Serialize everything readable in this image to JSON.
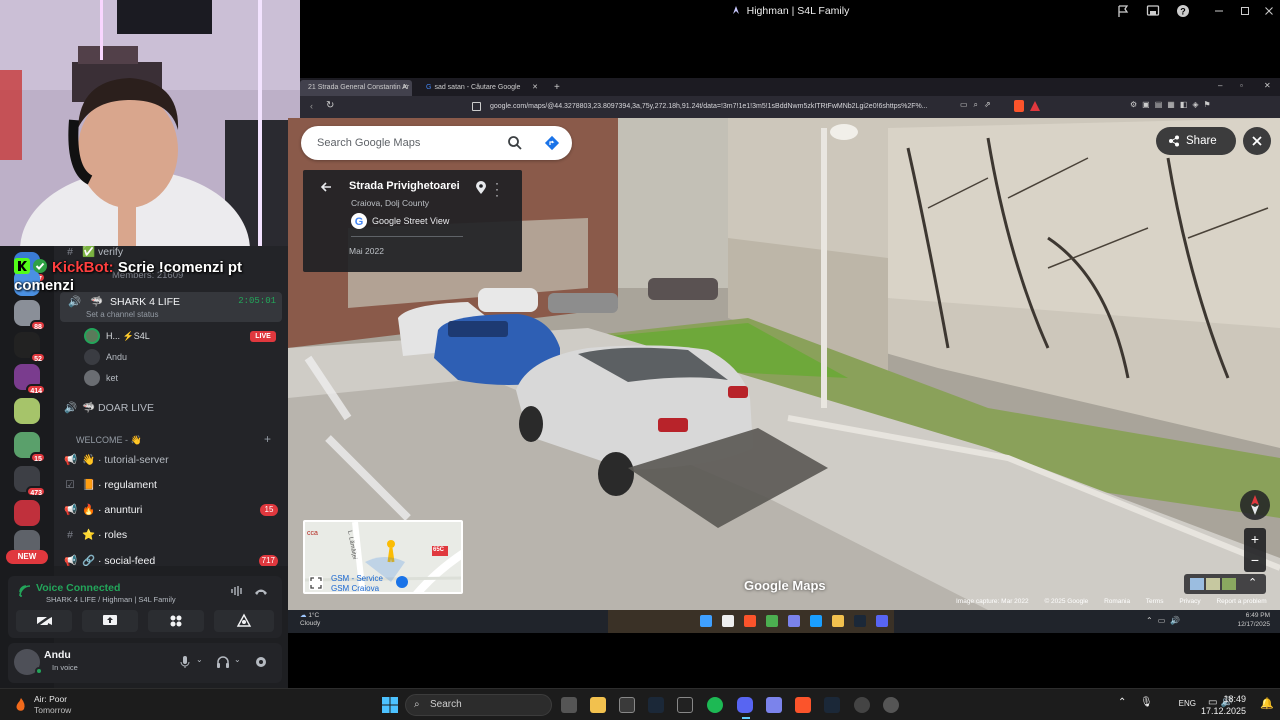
{
  "stream": {
    "window_title": "Highman | S4L Family"
  },
  "discord": {
    "members_line": "Members: 21609",
    "verify_label": "verify",
    "servers": [
      {
        "badge": "67",
        "color": "#3a7bd5"
      },
      {
        "badge": "",
        "color": "#4a90e2"
      },
      {
        "badge": "88",
        "color": "#8a8f98"
      },
      {
        "badge": "52",
        "color": "#222"
      },
      {
        "badge": "414",
        "color": "#7a3c8e"
      },
      {
        "badge": "",
        "color": "#a6c46a"
      },
      {
        "badge": "15",
        "color": "#5aa06b"
      },
      {
        "badge": "473",
        "color": "#3d3f45"
      },
      {
        "badge": "",
        "color": "#c0303c"
      },
      {
        "badge": "NEW",
        "color": "#5e6269"
      }
    ],
    "voice_channel": {
      "name": "SHARK 4 LIFE",
      "timer": "2:05:01",
      "status": "Set a channel status",
      "members": [
        {
          "name": "H... ⚡S4L",
          "live": "LIVE"
        },
        {
          "name": "Andu",
          "live": ""
        },
        {
          "name": "ket",
          "live": ""
        }
      ]
    },
    "doar_live": "DOAR LIVE",
    "category": "WELCOME - 👋",
    "channels": [
      {
        "icon": "📢",
        "emoji": "👋",
        "name": "tutorial-server",
        "badge": ""
      },
      {
        "icon": "☑",
        "emoji": "📙",
        "name": "regulament",
        "badge": ""
      },
      {
        "icon": "📢",
        "emoji": "🔥",
        "name": "anunturi",
        "badge": "15"
      },
      {
        "icon": "#",
        "emoji": "⭐",
        "name": "roles",
        "badge": ""
      },
      {
        "icon": "📢",
        "emoji": "🔗",
        "name": "social-feed",
        "badge": "717"
      }
    ],
    "voice_panel": {
      "title": "Voice Connected",
      "subtitle": "SHARK 4 LIFE / Highman | S4L Family"
    },
    "user": {
      "name": "Andu",
      "status": "In voice"
    }
  },
  "chat_overlay": {
    "bot_name": "KickBot:",
    "message": "Scrie !comenzi pt comenzi"
  },
  "browser": {
    "tabs": [
      {
        "label": "21 Strada General Constantin Ar"
      },
      {
        "label": "sad satan - Căutare Google"
      }
    ],
    "url": "google.com/maps/@44.3278803,23.8097394,3a,75y,272.18h,91.24t/data=!3m7!1e1!3m5!1sBddNwm5zkITRtFwMNb2Lgi2e0!6shttps%2F%..."
  },
  "maps": {
    "search_placeholder": "Search Google Maps",
    "place_title": "Strada Privighetoarei",
    "place_subtitle": "Craiova, Dolj County",
    "source_label": "Google Street View",
    "date_label": "Mai 2022",
    "share_label": "Share",
    "logo_text": "Google Maps",
    "minimap_labels": [
      "cca",
      "L. Lămâiței",
      "65C",
      "GSM - Service",
      "GSM Craiova"
    ],
    "attribution": [
      "Image capture: Mar 2022",
      "© 2025 Google",
      "Romania",
      "Terms",
      "Privacy",
      "Report a problem"
    ]
  },
  "inner_taskbar": {
    "temp": "1°C",
    "condition": "Cloudy",
    "time": "6:49 PM",
    "date": "12/17/2025"
  },
  "host_taskbar": {
    "weather_title": "Air: Poor",
    "weather_sub": "Tomorrow",
    "search_label": "Search",
    "lang": "ENG",
    "time": "18:49",
    "date": "17.12.2025"
  }
}
